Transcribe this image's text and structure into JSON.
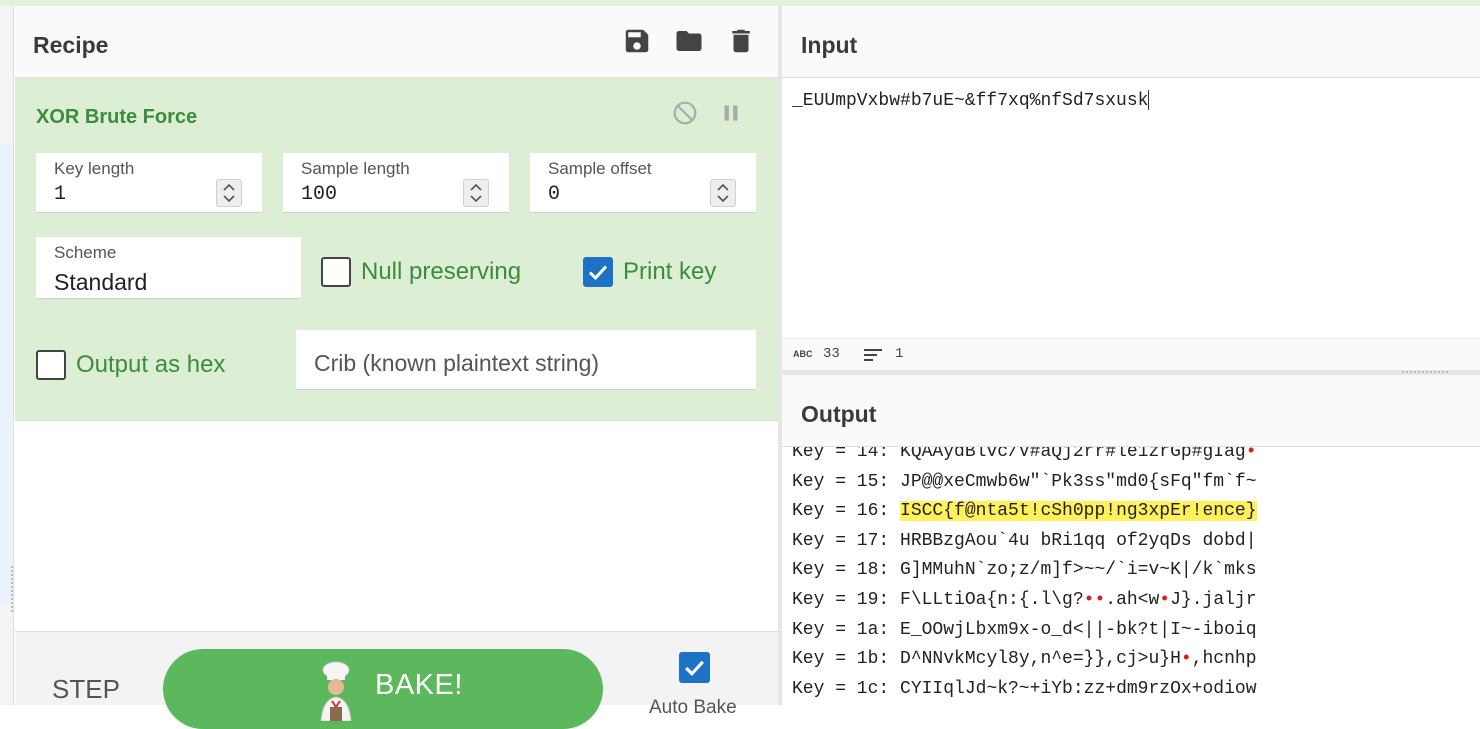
{
  "recipe": {
    "title": "Recipe",
    "icons": [
      "save-icon",
      "folder-icon",
      "trash-icon"
    ],
    "operation": {
      "title": "XOR Brute Force",
      "controls": [
        "disable-icon",
        "pause-icon"
      ],
      "key_length": {
        "label": "Key length",
        "value": "1"
      },
      "sample_length": {
        "label": "Sample length",
        "value": "100"
      },
      "sample_offset": {
        "label": "Sample offset",
        "value": "0"
      },
      "scheme": {
        "label": "Scheme",
        "value": "Standard"
      },
      "null_preserving": {
        "label": "Null preserving",
        "checked": false
      },
      "print_key": {
        "label": "Print key",
        "checked": true
      },
      "output_as_hex": {
        "label": "Output as hex",
        "checked": false
      },
      "crib": {
        "placeholder": "Crib (known plaintext string)"
      }
    },
    "step_label": "STEP",
    "bake_label": "BAKE!",
    "auto_bake": {
      "label": "Auto Bake",
      "checked": true
    }
  },
  "input": {
    "title": "Input",
    "text": "_EUUmpVxbw#b7uE~&ff7xq%nfSd7sxusk",
    "status": {
      "abc_label": "ABC",
      "length": "33",
      "lines": "1"
    }
  },
  "output": {
    "title": "Output",
    "lines": [
      {
        "prefix": "Key = 14: ",
        "text": "KQAAydBlvc/V#aQj2rr#le1zrGp#gIag",
        "dots_after": 1
      },
      {
        "prefix": "Key = 15: ",
        "text": "JP@@xeCmwb6w\"`Pk3ss\"md0{sFq\"fm`f~"
      },
      {
        "prefix": "Key = 16: ",
        "text": "ISCC{f@nta5t!cSh0pp!ng3xpEr!ence}",
        "highlight": true
      },
      {
        "prefix": "Key = 17: ",
        "text": "HRBBzgAou`4u bRi1qq of2yqDs dobd|"
      },
      {
        "prefix": "Key = 18: ",
        "text": "G]MMuhN`zo;z/m]f>~~/`i=v~K|/k`mks"
      },
      {
        "prefix": "Key = 19: ",
        "text_parts": [
          "F\\LLtiOa{n:{.l\\g?",
          "••",
          ".ah<w",
          "•",
          "J}.jaljr"
        ]
      },
      {
        "prefix": "Key = 1a: ",
        "text": "E_OOwjLbxm9x-o_d<||-bk?t|I~-iboiq"
      },
      {
        "prefix": "Key = 1b: ",
        "text_parts": [
          "D^NNvkMcyl8y,n^e=}},cj>u}H",
          "•",
          ",hcnhp"
        ]
      },
      {
        "prefix": "Key = 1c: ",
        "text": "CYIIqlJd~k?~+iYb:zz+dm9rzOx+odiow"
      }
    ]
  },
  "colors": {
    "op_bg": "#dcefd5",
    "op_title": "#3d8b3d",
    "bake_green": "#5cb85c",
    "checkbox_blue": "#1d72c8",
    "highlight": "#fff15a",
    "dot_red": "#e01b1b"
  }
}
